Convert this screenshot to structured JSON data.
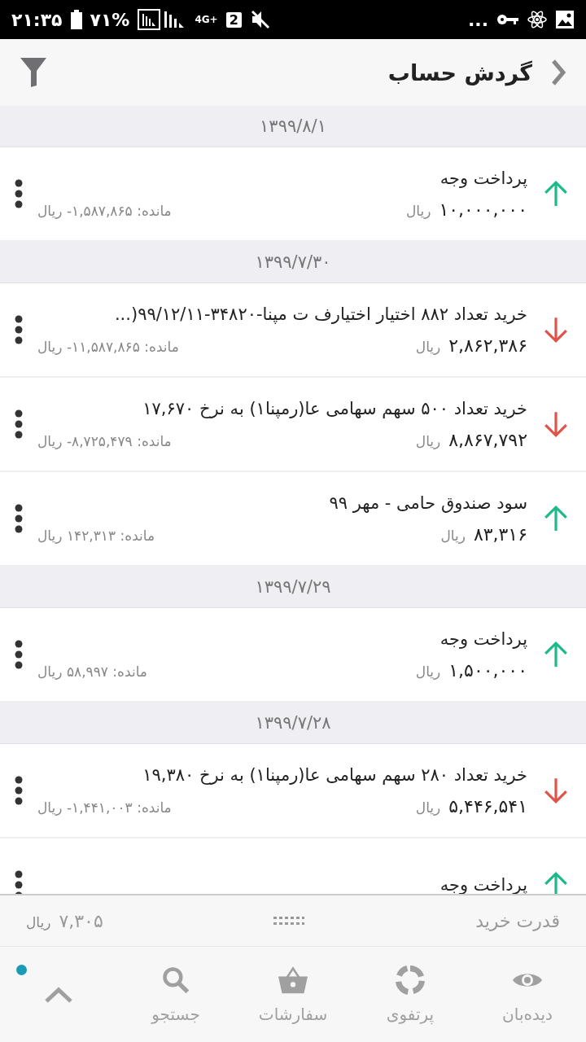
{
  "status_bar": {
    "time": "۲۱:۳۵",
    "battery": "۷۱%",
    "network": "4G+",
    "sim": "2",
    "more": "..."
  },
  "header": {
    "title": "گردش حساب"
  },
  "groups": [
    {
      "date": "۱۳۹۹/۸/۱",
      "items": [
        {
          "title": "پرداخت وجه",
          "amount": "۱۰,۰۰۰,۰۰۰",
          "currency": "ریال",
          "balance": "مانده: ۱,۵۸۷,۸۶۵- ریال",
          "credit": true
        }
      ]
    },
    {
      "date": "۱۳۹۹/۷/۳۰",
      "items": [
        {
          "title": "خرید تعداد ۸۸۲ اختیار اختیارف ت مپنا-۳۴۸۲۰-۹۹/۱۲/۱۱(...",
          "amount": "۲,۸۶۲,۳۸۶",
          "currency": "ریال",
          "balance": "مانده: ۱۱,۵۸۷,۸۶۵- ریال",
          "credit": false
        },
        {
          "title": "خرید تعداد ۵۰۰ سهم سهامی عا(رمپنا۱) به نرخ ۱۷,۶۷۰",
          "amount": "۸,۸۶۷,۷۹۲",
          "currency": "ریال",
          "balance": "مانده: ۸,۷۲۵,۴۷۹- ریال",
          "credit": false
        },
        {
          "title": "سود صندوق حامی - مهر ۹۹",
          "amount": "۸۳,۳۱۶",
          "currency": "ریال",
          "balance": "مانده: ۱۴۲,۳۱۳ ریال",
          "credit": true
        }
      ]
    },
    {
      "date": "۱۳۹۹/۷/۲۹",
      "items": [
        {
          "title": "پرداخت وجه",
          "amount": "۱,۵۰۰,۰۰۰",
          "currency": "ریال",
          "balance": "مانده: ۵۸,۹۹۷ ریال",
          "credit": true
        }
      ]
    },
    {
      "date": "۱۳۹۹/۷/۲۸",
      "items": [
        {
          "title": "خرید تعداد ۲۸۰ سهم سهامی عا(رمپنا۱) به نرخ ۱۹,۳۸۰",
          "amount": "۵,۴۴۶,۵۴۱",
          "currency": "ریال",
          "balance": "مانده: ۱,۴۴۱,۰۰۳- ریال",
          "credit": false
        },
        {
          "title": "پرداخت وجه",
          "credit": true
        }
      ]
    }
  ],
  "buying_power": {
    "label": "قدرت خرید",
    "amount": "۷,۳۰۵",
    "currency": "ریال"
  },
  "nav": {
    "items": [
      {
        "kind": "eye",
        "label": "دیده‌بان"
      },
      {
        "kind": "portfolio",
        "label": "پرتفوی"
      },
      {
        "kind": "basket",
        "label": "سفارشات"
      },
      {
        "kind": "search",
        "label": "جستجو"
      }
    ],
    "more_badge": true
  }
}
